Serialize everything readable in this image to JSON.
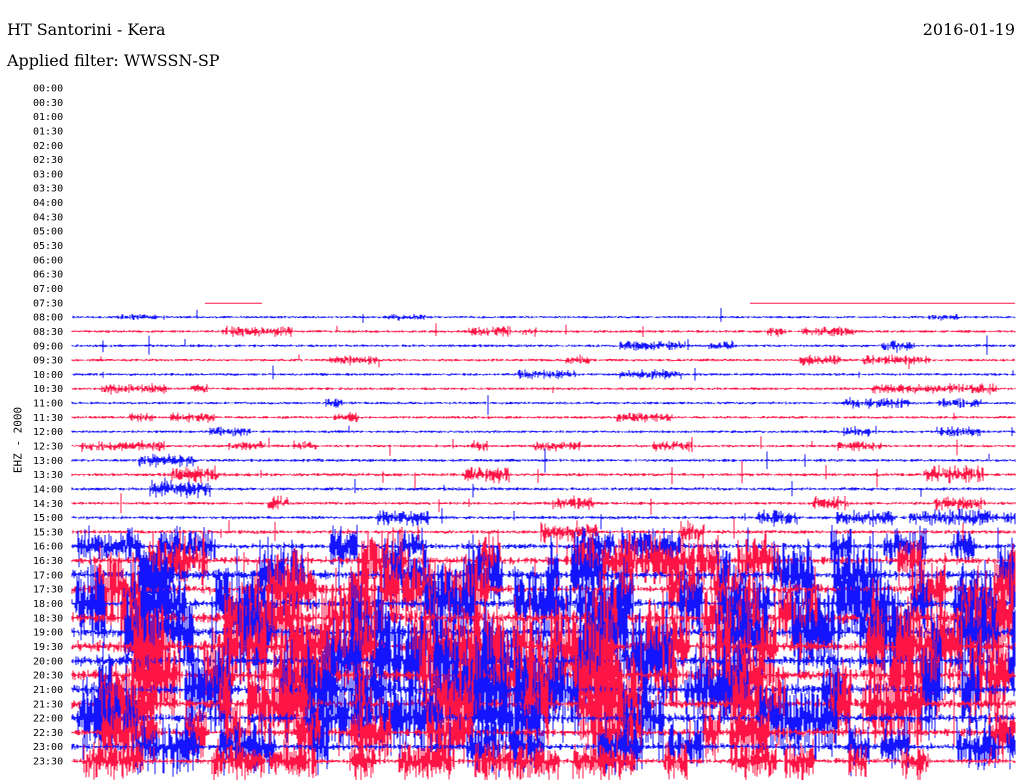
{
  "header": {
    "title": "HT Santorini - Kera",
    "date": "2016-01-19",
    "filter": "Applied filter: WWSSN-SP"
  },
  "chart_data": {
    "type": "line",
    "title": "HT Santorini - Kera",
    "subtitle": "Applied filter: WWSSN-SP",
    "ylabel": "EHZ - 2000",
    "colors": {
      "even": "#1414ff",
      "odd": "#ff1446"
    },
    "row_labels": [
      "00:00",
      "00:30",
      "01:00",
      "01:30",
      "02:00",
      "02:30",
      "03:00",
      "03:30",
      "04:00",
      "04:30",
      "05:00",
      "05:30",
      "06:00",
      "06:30",
      "07:00",
      "07:30",
      "08:00",
      "08:30",
      "09:00",
      "09:30",
      "10:00",
      "10:30",
      "11:00",
      "11:30",
      "12:00",
      "12:30",
      "13:00",
      "13:30",
      "14:00",
      "14:30",
      "15:00",
      "15:30",
      "16:00",
      "16:30",
      "17:00",
      "17:30",
      "18:00",
      "18:30",
      "19:00",
      "19:30",
      "20:00",
      "20:30",
      "21:00",
      "21:30",
      "22:00",
      "22:30",
      "23:00",
      "23:30"
    ],
    "activity_level": [
      0,
      0,
      0,
      0,
      0,
      0,
      0,
      0,
      0,
      0,
      0,
      0,
      0,
      0,
      0,
      0.3,
      1,
      1.5,
      1.5,
      1.5,
      1.5,
      1.5,
      1.5,
      1.5,
      1.5,
      1.5,
      2,
      2.5,
      2.5,
      2,
      2.5,
      3,
      6,
      9,
      12,
      12,
      13,
      14,
      15,
      15,
      15,
      15,
      15,
      14,
      12,
      10,
      8,
      6
    ]
  }
}
